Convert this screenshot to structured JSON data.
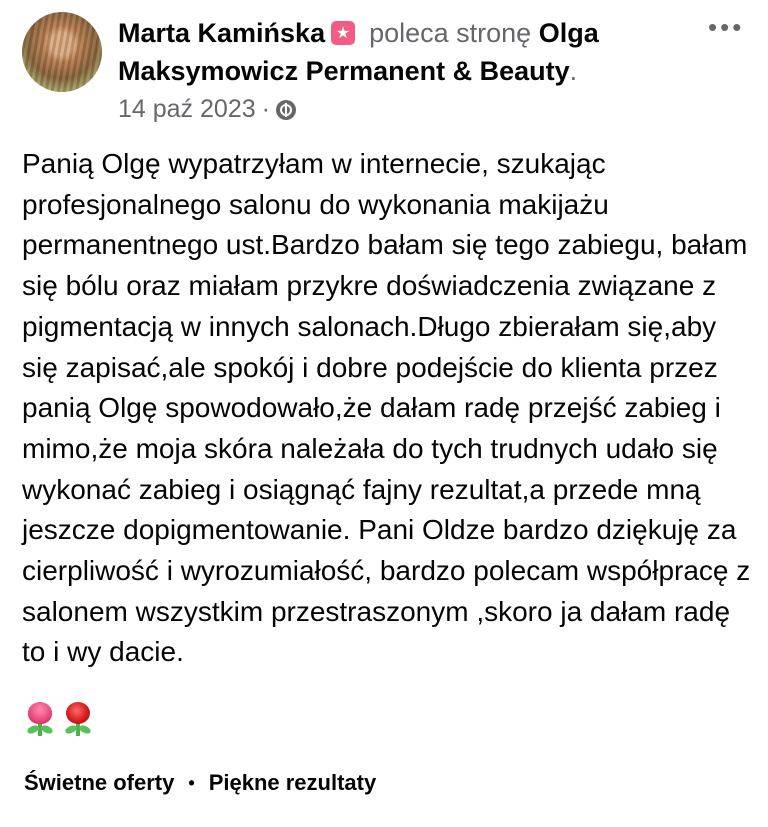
{
  "post": {
    "author": "Marta Kamińska",
    "action": "poleca stronę",
    "page_name": "Olga Maksymowicz Permanent & Beauty",
    "period": ".",
    "date": "14 paź 2023",
    "meta_separator": "·",
    "more_label": "•••",
    "body": "Panią Olgę wypatrzyłam w internecie, szukając profesjonalnego salonu do wykonania makijażu permanentnego ust.Bardzo bałam się tego zabiegu, bałam się bólu oraz miałam przykre doświadczenia związane z pigmentacją w innych salonach.Długo zbierałam się,aby się zapisać,ale spokój i dobre podejście do klienta przez panią Olgę spowodowało,że dałam radę przejść zabieg i mimo,że moja skóra należała do tych trudnych udało się wykonać zabieg i osiągnąć fajny rezultat,a przede mną jeszcze dopigmentowanie. Pani Oldze bardzo dziękuję za cierpliwość i wyrozumiałość, bardzo polecam współpracę z salonem wszystkim przestraszonym ,skoro ja dałam radę to i wy dacie.",
    "emojis": [
      "tulip-emoji",
      "rose-emoji"
    ],
    "tags": [
      "Świetne oferty",
      "Piękne rezultaty"
    ],
    "tag_separator": "•",
    "icons": {
      "recommend_badge": "recommend-star-icon",
      "audience": "globe-icon"
    },
    "colors": {
      "badge": "#f25c84",
      "secondary_text": "#65676b",
      "primary_text": "#050505"
    }
  }
}
